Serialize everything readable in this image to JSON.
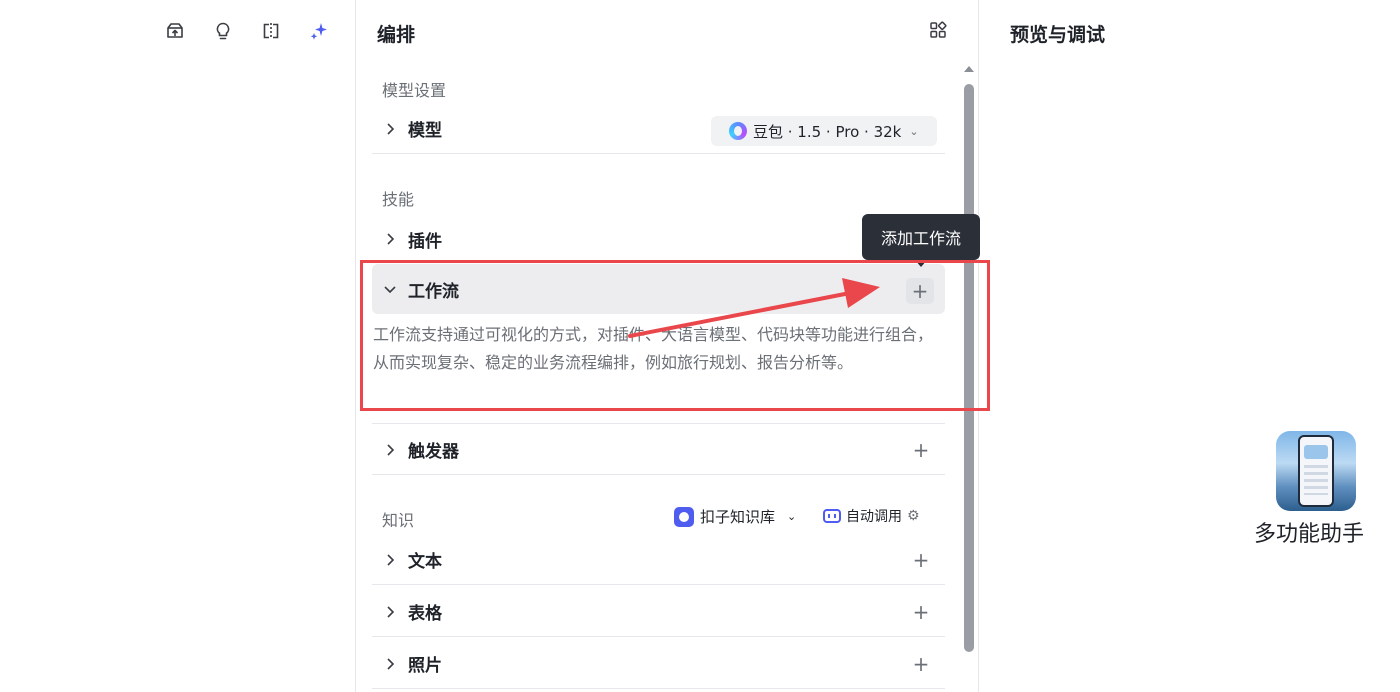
{
  "toolbar": {
    "icons": [
      "publish-icon",
      "bulb-icon",
      "split-view-icon",
      "sparkle-icon"
    ],
    "active_color": "#4e5cf0"
  },
  "edit_panel": {
    "title": "编排",
    "model_section": {
      "label": "模型设置",
      "model_row_label": "模型",
      "model_value": "豆包 · 1.5 · Pro · 32k"
    },
    "skills_section": {
      "label": "技能",
      "plugins_label": "插件",
      "workflow_label": "工作流",
      "workflow_description": "工作流支持通过可视化的方式，对插件、大语言模型、代码块等功能进行组合，从而实现复杂、稳定的业务流程编排，例如旅行规划、报告分析等。",
      "trigger_label": "触发器"
    },
    "knowledge_section": {
      "label": "知识",
      "kb_source": "扣子知识库",
      "auto_call": "自动调用",
      "items": [
        "文本",
        "表格",
        "照片"
      ]
    },
    "plus_glyph": "+",
    "tooltip": "添加工作流"
  },
  "preview_panel": {
    "title": "预览与调试",
    "app_name": "多功能助手"
  },
  "colors": {
    "highlight": "#e9474b",
    "tooltip_bg": "#2b2f38",
    "accent": "#4e5cf0"
  }
}
